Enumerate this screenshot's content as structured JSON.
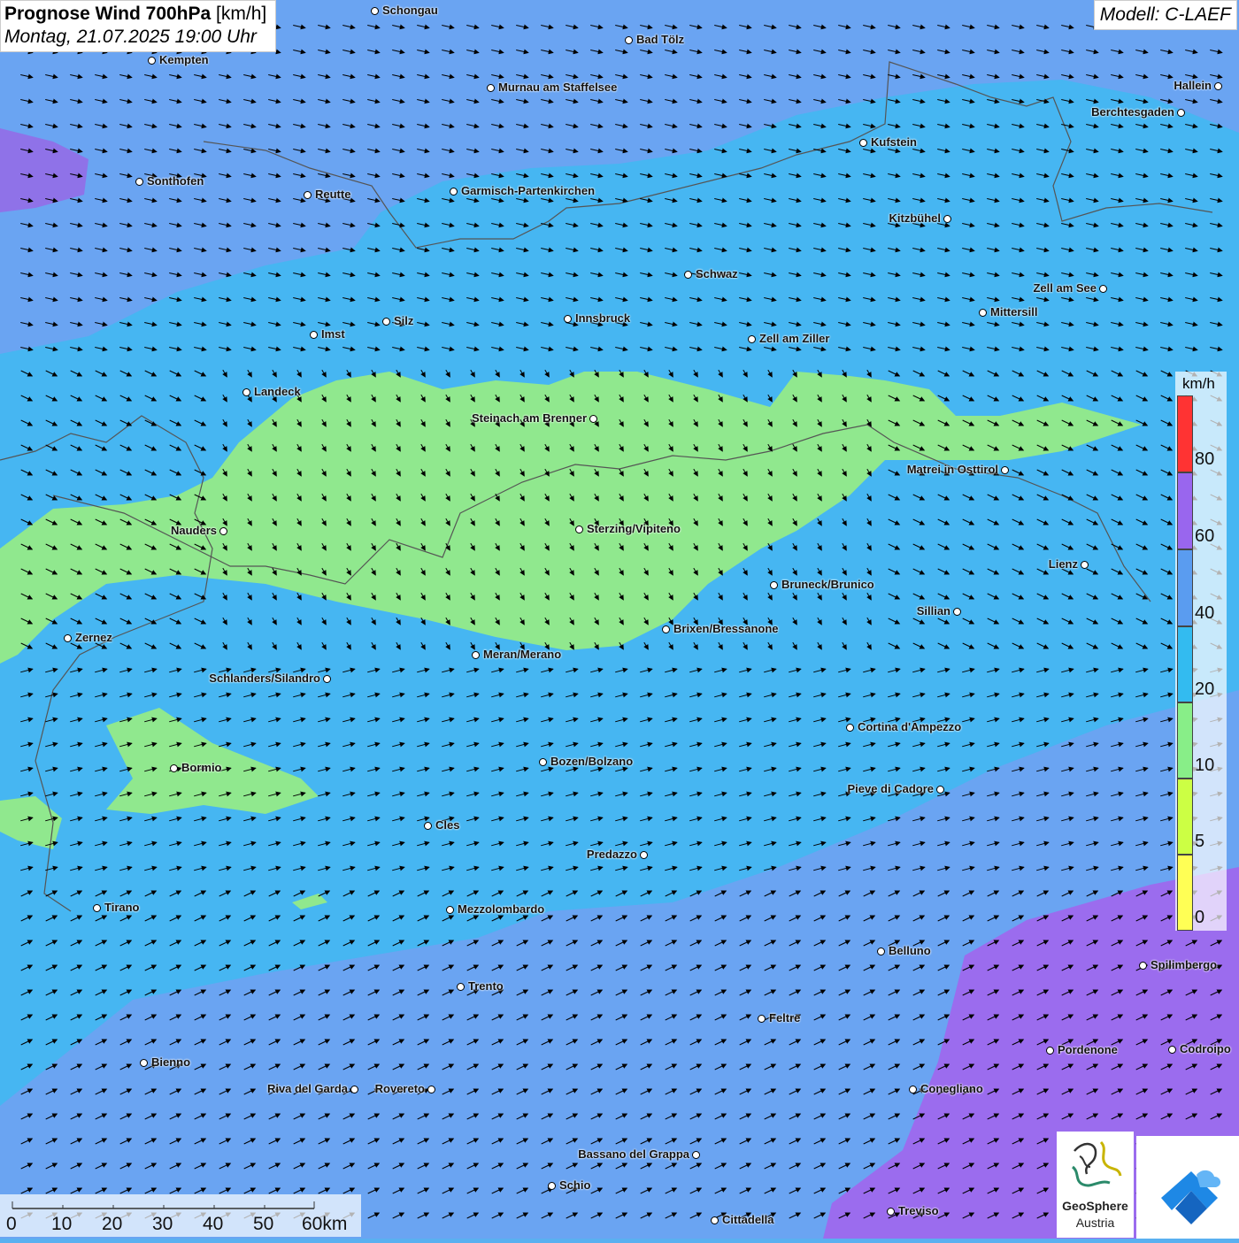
{
  "header": {
    "title_bold": "Prognose Wind 700hPa",
    "title_unit": "[km/h]",
    "date": "Montag, 21.07.2025 19:00 Uhr",
    "model": "Modell: C-LAEF"
  },
  "legend": {
    "unit": "km/h",
    "ticks": [
      "80",
      "60",
      "40",
      "20",
      "10",
      "5",
      "0"
    ],
    "colors": [
      "#ff3333",
      "#9966ee",
      "#5a9cf0",
      "#33bbf0",
      "#88ee88",
      "#ccff44",
      "#ffff55"
    ]
  },
  "scale_bar": {
    "labels": [
      "0",
      "10",
      "20",
      "30",
      "40",
      "50",
      "60km"
    ]
  },
  "logos": {
    "geosphere_name": "GeoSphere",
    "geosphere_sub": "Austria"
  },
  "cities": [
    {
      "name": "Schongau"
    },
    {
      "name": "Bad Tölz"
    },
    {
      "name": "Kempten"
    },
    {
      "name": "Murnau am Staffelsee"
    },
    {
      "name": "Hallein"
    },
    {
      "name": "Berchtesgaden"
    },
    {
      "name": "Kufstein"
    },
    {
      "name": "Sonthofen"
    },
    {
      "name": "Reutte"
    },
    {
      "name": "Garmisch-Partenkirchen"
    },
    {
      "name": "Kitzbühel"
    },
    {
      "name": "Schwaz"
    },
    {
      "name": "Zell am See"
    },
    {
      "name": "Mittersill"
    },
    {
      "name": "Innsbruck"
    },
    {
      "name": "Silz"
    },
    {
      "name": "Imst"
    },
    {
      "name": "Zell am Ziller"
    },
    {
      "name": "Landeck"
    },
    {
      "name": "Steinach am Brenner"
    },
    {
      "name": "Matrei in Osttirol"
    },
    {
      "name": "Nauders"
    },
    {
      "name": "Sterzing/Vipiteno"
    },
    {
      "name": "Lienz"
    },
    {
      "name": "Bruneck/Brunico"
    },
    {
      "name": "Sillian"
    },
    {
      "name": "Zernez"
    },
    {
      "name": "Brixen/Bressanone"
    },
    {
      "name": "Meran/Merano"
    },
    {
      "name": "Schlanders/Silandro"
    },
    {
      "name": "Cortina d'Ampezzo"
    },
    {
      "name": "Bozen/Bolzano"
    },
    {
      "name": "Bormio"
    },
    {
      "name": "Pieve di Cadore"
    },
    {
      "name": "Cles"
    },
    {
      "name": "Predazzo"
    },
    {
      "name": "Tirano"
    },
    {
      "name": "Mezzolombardo"
    },
    {
      "name": "Belluno"
    },
    {
      "name": "Spilimbergo"
    },
    {
      "name": "Trento"
    },
    {
      "name": "Feltre"
    },
    {
      "name": "Bienno"
    },
    {
      "name": "Pordenone"
    },
    {
      "name": "Codroipo"
    },
    {
      "name": "Riva del Garda"
    },
    {
      "name": "Rovereto"
    },
    {
      "name": "Conegliano"
    },
    {
      "name": "Bassano del Grappa"
    },
    {
      "name": "Schio"
    },
    {
      "name": "Treviso"
    },
    {
      "name": "Cittadella"
    }
  ]
}
